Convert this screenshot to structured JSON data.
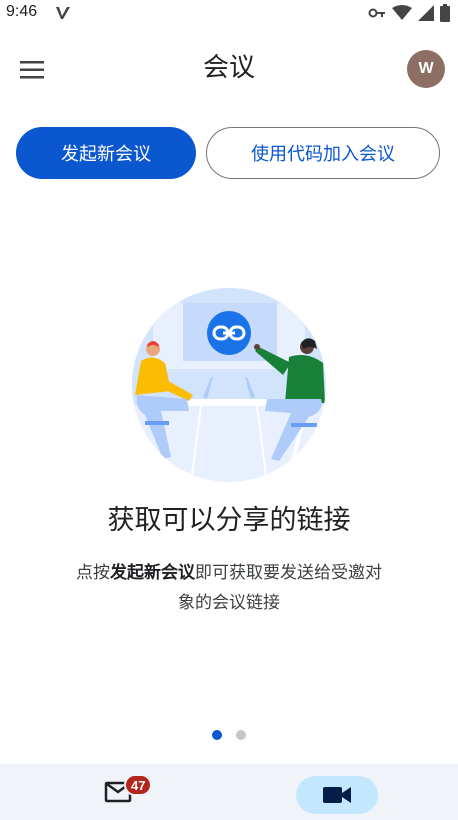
{
  "status_bar": {
    "time": "9:46",
    "left_icon": "v-notification-icon",
    "right_icons": [
      "vpn-key-icon",
      "wifi-icon",
      "signal-icon",
      "battery-icon"
    ]
  },
  "app_bar": {
    "title": "会议",
    "menu_icon": "menu-icon",
    "avatar_initial": "W",
    "avatar_color": "#8d6e63"
  },
  "actions": {
    "new_meeting_label": "发起新会议",
    "join_with_code_label": "使用代码加入会议"
  },
  "onboarding": {
    "heading": "获取可以分享的链接",
    "desc_prefix": "点按",
    "desc_bold": "发起新会议",
    "desc_suffix": "即可获取要发送给受邀对象的会议链接",
    "page_count": 2,
    "current_page": 1
  },
  "bottom_nav": {
    "mail_icon": "mail-icon",
    "mail_badge": "47",
    "meet_icon": "videocam-icon"
  },
  "colors": {
    "primary": "#0b57d0",
    "badge": "#b3261e",
    "nav_background": "#f0f4f9",
    "active_pill": "#c2e7ff"
  }
}
